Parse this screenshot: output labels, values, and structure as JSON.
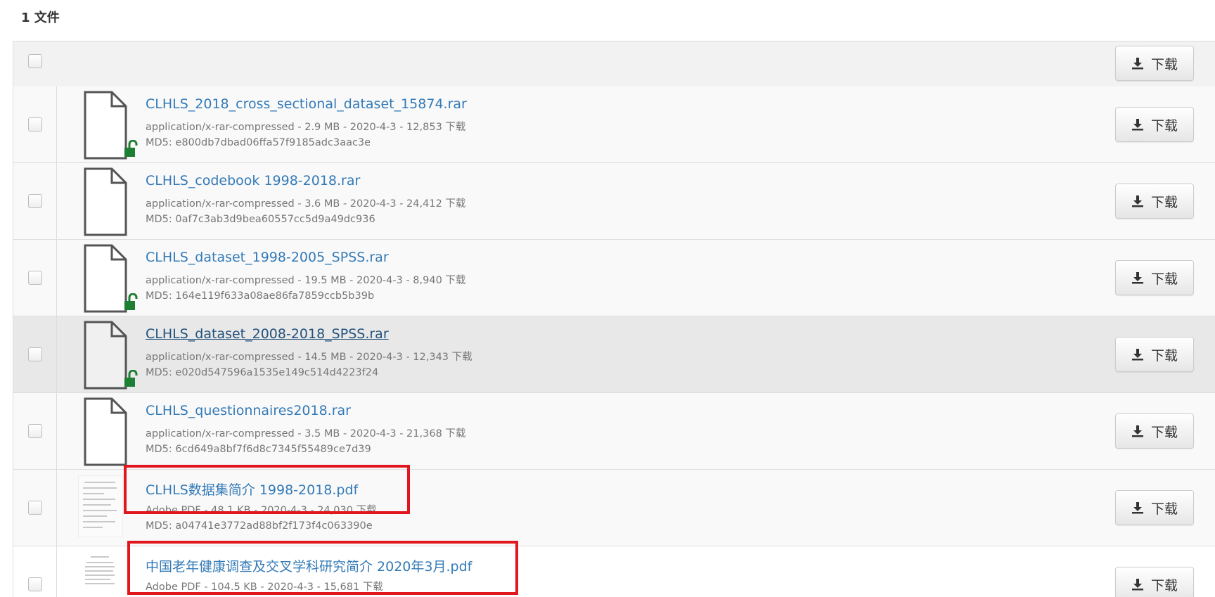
{
  "header": {
    "count_label": "1 文件"
  },
  "table": {
    "download_all_label": "下载",
    "files": [
      {
        "name": "CLHLS_2018_cross_sectional_dataset_15874.rar",
        "meta": "application/x-rar-compressed - 2.9 MB - 2020-4-3 - 12,853 下载",
        "md5": "MD5: e800db7dbad06ffa57f9185adc3aac3e",
        "download_label": "下载",
        "icon": "file-icon",
        "unlocked": true
      },
      {
        "name": "CLHLS_codebook 1998-2018.rar",
        "meta": "application/x-rar-compressed - 3.6 MB - 2020-4-3 - 24,412 下载",
        "md5": "MD5: 0af7c3ab3d9bea60557cc5d9a49dc936",
        "download_label": "下载",
        "icon": "file-icon",
        "unlocked": false
      },
      {
        "name": "CLHLS_dataset_1998-2005_SPSS.rar",
        "meta": "application/x-rar-compressed - 19.5 MB - 2020-4-3 - 8,940 下载",
        "md5": "MD5: 164e119f633a08ae86fa7859ccb5b39b",
        "download_label": "下载",
        "icon": "file-icon",
        "unlocked": true
      },
      {
        "name": "CLHLS_dataset_2008-2018_SPSS.rar",
        "meta": "application/x-rar-compressed - 14.5 MB - 2020-4-3 - 12,343 下载",
        "md5": "MD5: e020d547596a1535e149c514d4223f24",
        "download_label": "下载",
        "icon": "file-icon",
        "unlocked": true
      },
      {
        "name": "CLHLS_questionnaires2018.rar",
        "meta": "application/x-rar-compressed - 3.5 MB - 2020-4-3 - 21,368 下载",
        "md5": "MD5: 6cd649a8bf7f6d8c7345f55489ce7d39",
        "download_label": "下载",
        "icon": "file-icon",
        "unlocked": false
      },
      {
        "name": "CLHLS数据集简介 1998-2018.pdf",
        "meta": "Adobe PDF - 48.1 KB - 2020-4-3 - 24,030 下载",
        "md5": "MD5: a04741e3772ad88bf2f173f4c063390e",
        "download_label": "下载",
        "icon": "pdf-thumbnail",
        "unlocked": false
      },
      {
        "name": "中国老年健康调查及交叉学科研究简介 2020年3月.pdf",
        "meta": "Adobe PDF - 104.5 KB - 2020-4-3 - 15,681 下载",
        "md5": "",
        "download_label": "下载",
        "icon": "pdf-thumbnail",
        "unlocked": false
      }
    ]
  },
  "colors": {
    "link": "#337ab7",
    "highlight_box": "#e2161e",
    "lock_green": "#1e7e34"
  }
}
